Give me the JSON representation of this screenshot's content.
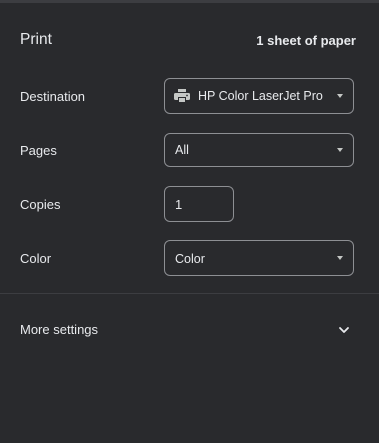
{
  "header": {
    "title": "Print",
    "summary": "1 sheet of paper"
  },
  "destination": {
    "label": "Destination",
    "value": "HP Color LaserJet Pro M",
    "icon": "printer-icon"
  },
  "pages": {
    "label": "Pages",
    "value": "All"
  },
  "copies": {
    "label": "Copies",
    "value": "1"
  },
  "color": {
    "label": "Color",
    "value": "Color"
  },
  "more_settings": {
    "label": "More settings",
    "icon": "chevron-down-icon"
  },
  "colors": {
    "background": "#292a2d",
    "text": "#e8eaed",
    "border": "#8d8f93"
  }
}
